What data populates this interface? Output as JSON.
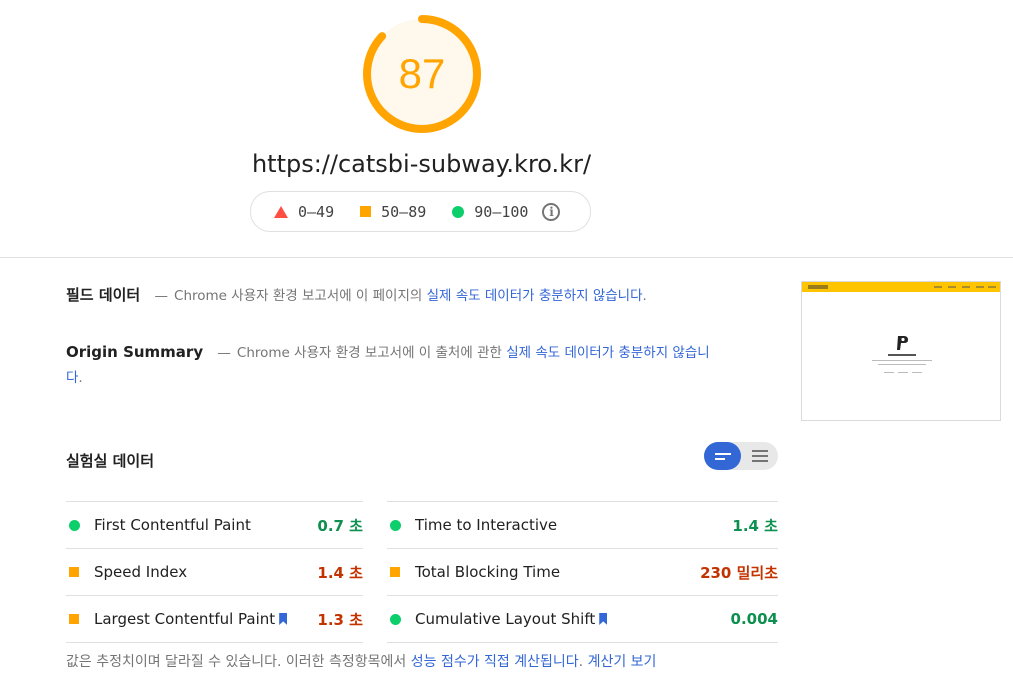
{
  "score": {
    "value": "87",
    "fraction": 0.87,
    "color": "#ffa400"
  },
  "url": "https://catsbi-subway.kro.kr/",
  "legend": [
    {
      "icon": "triangle-icon",
      "label": "0–49",
      "color": "#ff4e42"
    },
    {
      "icon": "square-icon",
      "label": "50–89",
      "color": "#ffa400"
    },
    {
      "icon": "circle-icon",
      "label": "90–100",
      "color": "#0cce6b"
    }
  ],
  "field_data": {
    "title": "필드 데이터",
    "dash": "—",
    "prefix": "Chrome",
    "text": " 사용자 환경 보고서에 이 페이지의 ",
    "link": "실제 속도 데이터가 충분하지 않습니다",
    "suffix": "."
  },
  "origin_summary": {
    "title": "Origin Summary",
    "dash": "—",
    "prefix": "Chrome",
    "text": " 사용자 환경 보고서에 이 출처에 관한 ",
    "link": "실제 속도 데이터가 충분하지 않습니",
    "link_cont": "다",
    "suffix": "."
  },
  "lab_data": {
    "title": "실험실 데이터",
    "metrics_left": [
      {
        "name": "First Contentful Paint",
        "value": "0.7 초",
        "rating": "good",
        "bookmark": false
      },
      {
        "name": "Speed Index",
        "value": "1.4 초",
        "rating": "average",
        "bookmark": false
      },
      {
        "name": "Largest Contentful Paint",
        "value": "1.3 초",
        "rating": "average",
        "bookmark": true
      }
    ],
    "metrics_right": [
      {
        "name": "Time to Interactive",
        "value": "1.4 초",
        "rating": "good",
        "bookmark": false
      },
      {
        "name": "Total Blocking Time",
        "value": "230 밀리초",
        "rating": "average",
        "bookmark": false
      },
      {
        "name": "Cumulative Layout Shift",
        "value": "0.004",
        "rating": "good",
        "bookmark": true
      }
    ]
  },
  "footnote": {
    "text": "값은 추정치이며 달라질 수 있습니다. 이러한 측정항목에서 ",
    "link1": "성능 점수가 직접 계산됩니다",
    "sep": ". ",
    "link2": "계산기 보기"
  },
  "colors": {
    "good": "#0d904f",
    "average": "#c33300",
    "accent": "#3367d6"
  }
}
